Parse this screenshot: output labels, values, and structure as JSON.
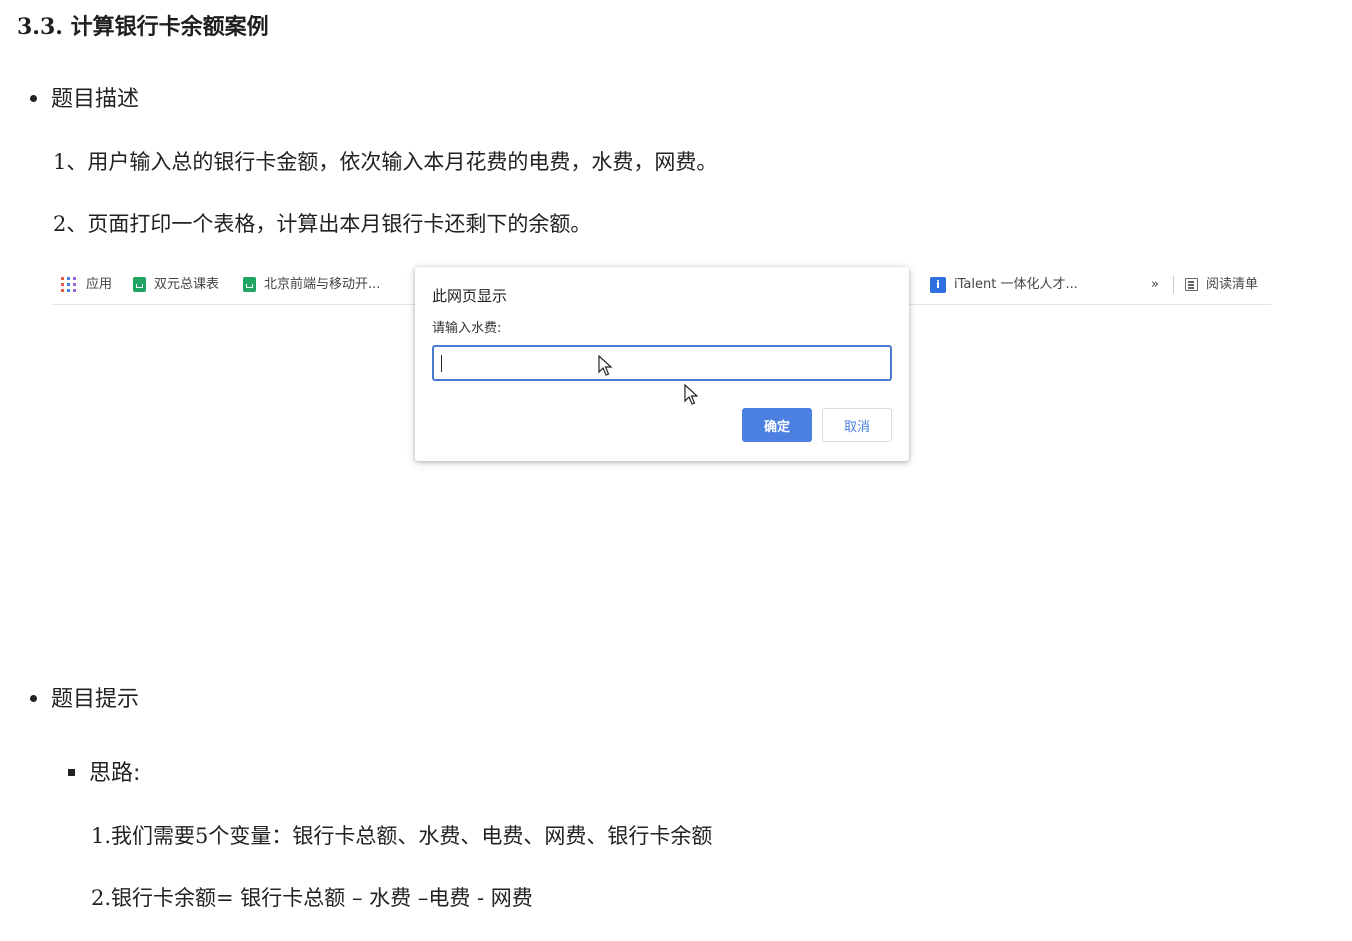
{
  "section": {
    "title": "3.3. 计算银行卡余额案例"
  },
  "description": {
    "heading": "题目描述",
    "items": [
      "1、用户输入总的银行卡金额，依次输入本月花费的电费，水费，网费。",
      "2、页面打印一个表格，计算出本月银行卡还剩下的余额。"
    ]
  },
  "screenshot": {
    "bookmarks": {
      "apps": "应用",
      "items": [
        "双元总课表",
        "北京前端与移动开...",
        "iTalent 一体化人才..."
      ],
      "more": "»",
      "reading_list": "阅读清单"
    },
    "dialog": {
      "title": "此网页显示",
      "message": "请输入水费:",
      "input_value": "",
      "ok_label": "确定",
      "cancel_label": "取消"
    }
  },
  "hints": {
    "heading": "题目提示",
    "sub_heading": "思路:",
    "lines": [
      "1.我们需要5个变量：银行卡总额、水费、电费、网费、银行卡余额",
      "2.银行卡余额= 银行卡总额 – 水费 –电费  - 网费"
    ]
  },
  "colors": {
    "accent": "#4b7fe0",
    "sheet_icon": "#1fa463",
    "info_icon": "#2f6fe0"
  },
  "icons": [
    "apps-grid-icon",
    "sheet-icon",
    "info-icon",
    "reading-list-icon",
    "mouse-pointer-icon"
  ]
}
